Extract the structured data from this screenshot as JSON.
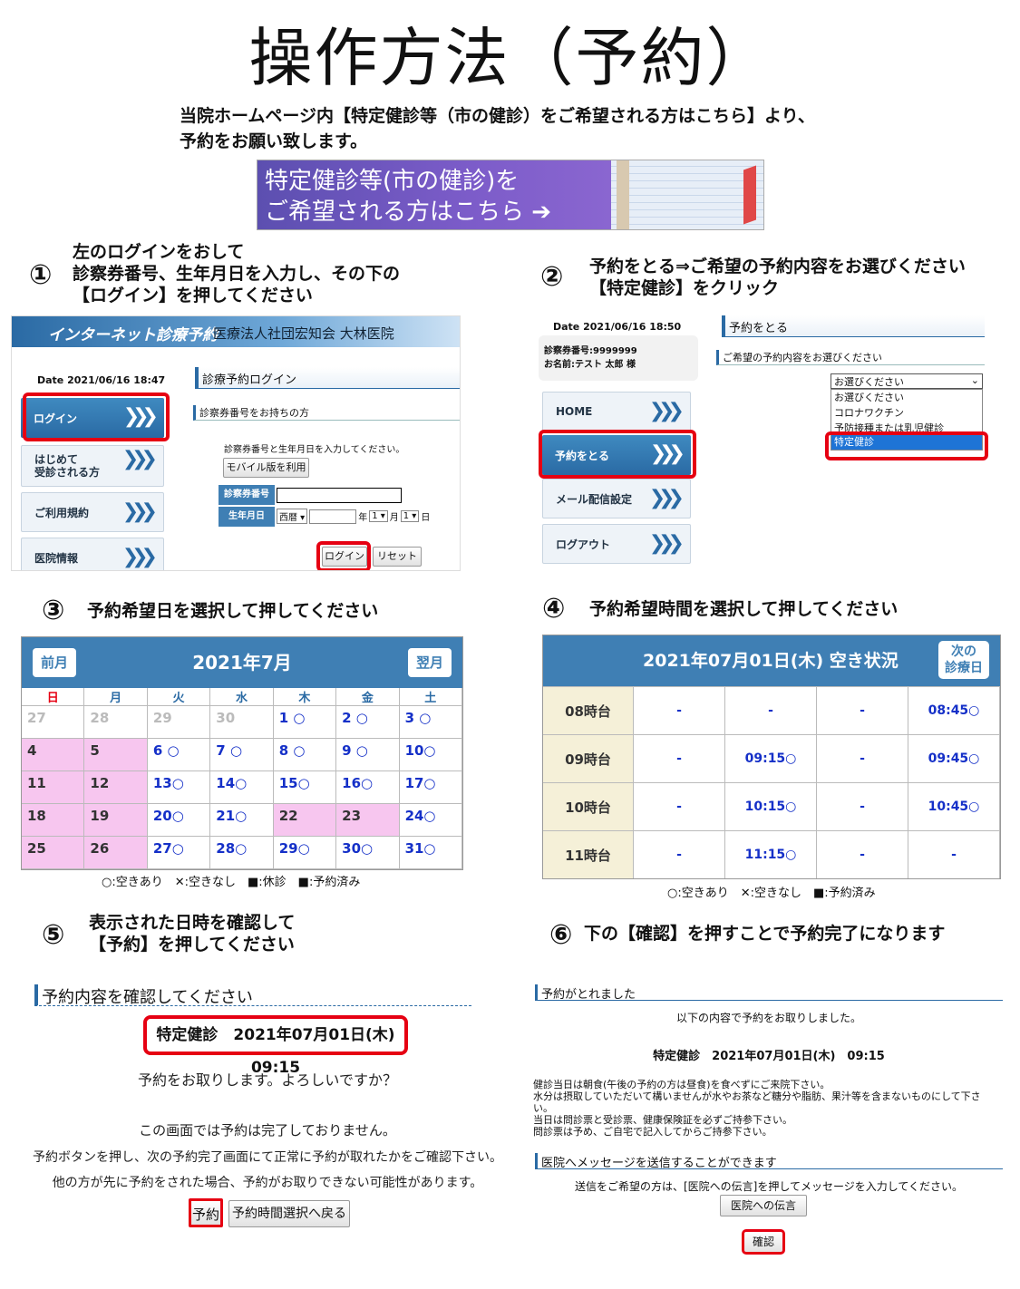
{
  "title": "操作方法（予約）",
  "intro": [
    "当院ホームページ内【特定健診等（市の健診）をご希望される方はこちら】より、",
    "予約をお願い致します。"
  ],
  "banner": {
    "line1": "特定健診等(市の健診)を",
    "line2": "ご希望される方はこちら ➔"
  },
  "steps": {
    "s1": {
      "num": "①",
      "lines": [
        "左のログインをおして",
        "診察券番号、生年月日を入力し、その下の",
        "【ログイン】を押してください"
      ]
    },
    "s2": {
      "num": "②",
      "lines": [
        "予約をとる⇒ご希望の予約内容をお選びください",
        "【特定健診】をクリック"
      ]
    },
    "s3": {
      "num": "③",
      "text": "予約希望日を選択して押してください"
    },
    "s4": {
      "num": "④",
      "text": "予約希望時間を選択して押してください"
    },
    "s5": {
      "num": "⑤",
      "lines": [
        "表示された日時を確認して",
        "【予約】を押してください"
      ]
    },
    "s6": {
      "num": "⑥",
      "text": "下の【確認】を押すことで予約完了になります"
    }
  },
  "login": {
    "header": "インターネット診療予約",
    "hospital": "医療法人社団宏知会 大林医院",
    "date": "Date 2021/06/16 18:47",
    "nav": [
      "ログイン",
      "はじめて\n受診される方",
      "ご利用規約",
      "医院情報"
    ],
    "panel_title": "診療予約ログイン",
    "sub": "診察券番号をお持ちの方",
    "hint": "診察券番号と生年月日を入力してください。",
    "mobile": "モバイル版を利用",
    "label_id": "診察券番号",
    "label_dob": "生年月日",
    "era": "西暦 ▾",
    "y": "年",
    "m_val": "1 ▾",
    "m": "月",
    "d_val": "1 ▾",
    "d": "日",
    "login_btn": "ログイン",
    "reset_btn": "リセット"
  },
  "reserve": {
    "date": "Date 2021/06/16 18:50",
    "card": "診察券番号:9999999",
    "name": "お名前:テスト 太郎 様",
    "nav": [
      "HOME",
      "予約をとる",
      "メール配信設定",
      "ログアウト"
    ],
    "panel_title": "予約をとる",
    "sub": "ご希望の予約内容をお選びください",
    "select": "お選びください",
    "options": [
      "お選びください",
      "コロナワクチン",
      "予防接種または乳児健診",
      "特定健診"
    ]
  },
  "calendar": {
    "prev": "前月",
    "title": "2021年7月",
    "next": "翌月",
    "dow": [
      "日",
      "月",
      "火",
      "水",
      "木",
      "金",
      "土"
    ],
    "rows": [
      [
        "27",
        "28",
        "29",
        "30",
        "1 ○",
        "2 ○",
        "3 ○"
      ],
      [
        "4",
        "5",
        "6 ○",
        "7 ○",
        "8 ○",
        "9 ○",
        "10○"
      ],
      [
        "11",
        "12",
        "13○",
        "14○",
        "15○",
        "16○",
        "17○"
      ],
      [
        "18",
        "19",
        "20○",
        "21○",
        "22",
        "23",
        "24○"
      ],
      [
        "25",
        "26",
        "27○",
        "28○",
        "29○",
        "30○",
        "31○"
      ]
    ],
    "legend": "○:空きあり　✕:空きなし　■:休診　■:予約済み"
  },
  "times": {
    "title": "2021年07月01日(木) 空き状況",
    "next": "次の\n診療日",
    "rows": [
      [
        "08時台",
        "-",
        "-",
        "-",
        "08:45○"
      ],
      [
        "09時台",
        "-",
        "09:15○",
        "-",
        "09:45○"
      ],
      [
        "10時台",
        "-",
        "10:15○",
        "-",
        "10:45○"
      ],
      [
        "11時台",
        "-",
        "11:15○",
        "-",
        "-"
      ]
    ],
    "legend": "○:空きあり　✕:空きなし　■:予約済み"
  },
  "confirm": {
    "title": "予約内容を確認してください",
    "detail": "特定健診　2021年07月01日(木)　09:15",
    "q": "予約をお取りします。よろしいですか？",
    "n1": "この画面では予約は完了しておりません。",
    "n2": "予約ボタンを押し、次の予約完了画面にて正常に予約が取れたかをご確認下さい。",
    "n3": "他の方が先に予約をされた場合、予約がお取りできない可能性があります。",
    "btn_ok": "予約",
    "btn_back": "予約時間選択へ戻る"
  },
  "done": {
    "title": "予約がとれました",
    "l1": "以下の内容で予約をお取りしました。",
    "detail": "特定健診　2021年07月01日(木)　09:15",
    "notes": [
      "健診当日は朝食(午後の予約の方は昼食)を食べずにご来院下さい。",
      "水分は摂取していただいて構いませんが水やお茶など糖分や脂肪、果汁等を含まないものにして下さい。",
      "当日は問診票と受診票、健康保険証を必ずご持参下さい。",
      "問診票は予め、ご自宅で記入してからご持参下さい。"
    ],
    "msg_title": "医院へメッセージを送信することができます",
    "msg": "送信をご希望の方は、[医院への伝言]を押してメッセージを入力してください。",
    "msg_btn": "医院への伝言",
    "confirm_btn": "確認"
  },
  "colors": {
    "accent": "#3f7fb4",
    "red": "#e60012",
    "rest": "#f7c6ef",
    "booked": "#22c322"
  }
}
